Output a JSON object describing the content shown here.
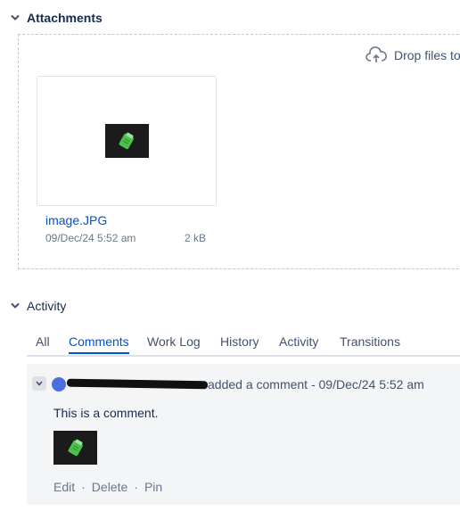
{
  "attachments": {
    "title": "Attachments",
    "drop_hint": "Drop files to",
    "file": {
      "name": "image.JPG",
      "date": "09/Dec/24 5:52 am",
      "size": "2 kB"
    }
  },
  "activity": {
    "title": "Activity",
    "tabs": [
      {
        "label": "All"
      },
      {
        "label": "Comments"
      },
      {
        "label": "Work Log"
      },
      {
        "label": "History"
      },
      {
        "label": "Activity"
      },
      {
        "label": "Transitions"
      }
    ],
    "active_tab": "Comments",
    "comment": {
      "header": "added a comment - 09/Dec/24 5:52 am",
      "body": "This is a comment.",
      "actions": {
        "edit": "Edit",
        "delete": "Delete",
        "pin": "Pin",
        "separator": "·"
      }
    }
  },
  "colors": {
    "link": "#0052cc",
    "muted": "#6b778c",
    "comment_bg": "#f4f5f7"
  }
}
